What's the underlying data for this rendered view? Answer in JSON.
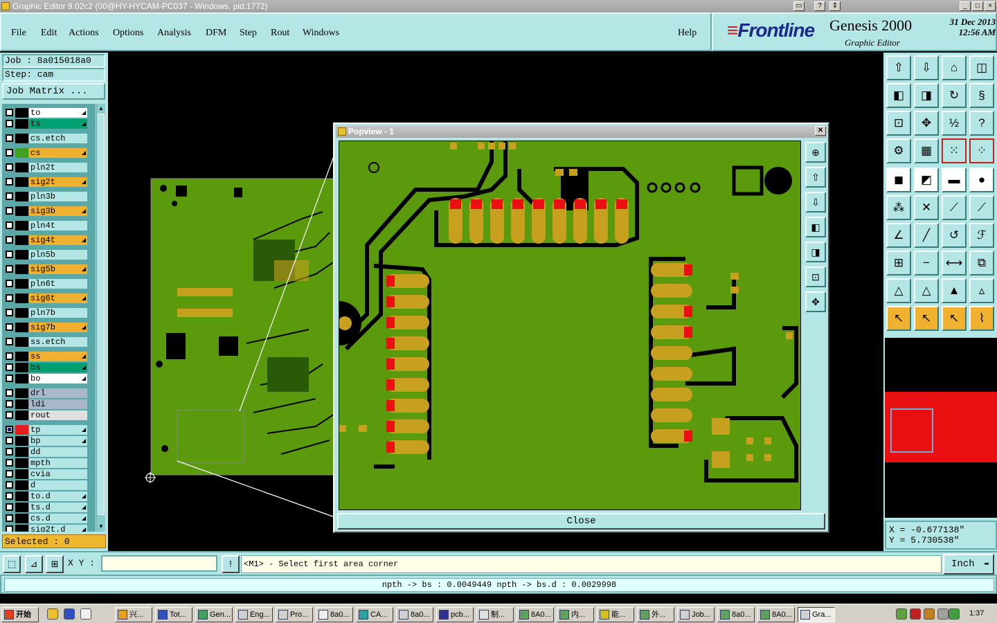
{
  "window": {
    "title": "Graphic Editor 9.02c2 (00@HY-HYCAM-PC037 - Windows, pid:1772)",
    "controls": [
      "_",
      "□",
      "×"
    ],
    "helpers": [
      "▭",
      "?",
      "⇕"
    ]
  },
  "menu": {
    "items": [
      "File",
      "Edit",
      "Actions",
      "Options",
      "Analysis",
      "DFM",
      "Step",
      "Rout",
      "Windows"
    ],
    "help": "Help"
  },
  "brand": {
    "logo": "Frontline",
    "product": "Genesis 2000",
    "subtitle": "Graphic Editor",
    "date": "31 Dec 2013",
    "time": "12:56 AM"
  },
  "job": {
    "job_line": "Job : 8a015018a0",
    "step_line": "Step: cam",
    "matrix_button": "Job Matrix ..."
  },
  "layers": [
    {
      "name": "to",
      "color": "#ffffff",
      "swatch": "#000000",
      "arrow": true
    },
    {
      "name": "ts",
      "color": "#00a070",
      "swatch": "#000000",
      "arrow": true
    },
    {
      "name": "cs.etch",
      "color": "#b4e6e6",
      "swatch": "#000000",
      "arrow": false
    },
    {
      "name": "cs",
      "color": "#f0b030",
      "swatch": "#40a020",
      "arrow": true
    },
    {
      "name": "pln2t",
      "color": "#b4e6e6",
      "swatch": "#000000",
      "arrow": false
    },
    {
      "name": "sig2t",
      "color": "#f0b030",
      "swatch": "#000000",
      "arrow": true
    },
    {
      "name": "pln3b",
      "color": "#b4e6e6",
      "swatch": "#000000",
      "arrow": false
    },
    {
      "name": "sig3b",
      "color": "#f0b030",
      "swatch": "#000000",
      "arrow": true
    },
    {
      "name": "pln4t",
      "color": "#b4e6e6",
      "swatch": "#000000",
      "arrow": false
    },
    {
      "name": "sig4t",
      "color": "#f0b030",
      "swatch": "#000000",
      "arrow": true
    },
    {
      "name": "pln5b",
      "color": "#b4e6e6",
      "swatch": "#000000",
      "arrow": false
    },
    {
      "name": "sig5b",
      "color": "#f0b030",
      "swatch": "#000000",
      "arrow": true
    },
    {
      "name": "pln6t",
      "color": "#b4e6e6",
      "swatch": "#000000",
      "arrow": false
    },
    {
      "name": "sig6t",
      "color": "#f0b030",
      "swatch": "#000000",
      "arrow": true
    },
    {
      "name": "pln7b",
      "color": "#b4e6e6",
      "swatch": "#000000",
      "arrow": false
    },
    {
      "name": "sig7b",
      "color": "#f0b030",
      "swatch": "#000000",
      "arrow": true
    },
    {
      "name": "ss.etch",
      "color": "#b4e6e6",
      "swatch": "#000000",
      "arrow": false
    },
    {
      "name": "ss",
      "color": "#f0b030",
      "swatch": "#000000",
      "arrow": true
    },
    {
      "name": "bs",
      "color": "#00a070",
      "swatch": "#000000",
      "arrow": true
    },
    {
      "name": "bo",
      "color": "#ffffff",
      "swatch": "#000000",
      "arrow": true
    },
    {
      "name": "drl",
      "color": "#a8b8c8",
      "swatch": "#000000",
      "arrow": false
    },
    {
      "name": "ldi",
      "color": "#a8b8c8",
      "swatch": "#000000",
      "arrow": false
    },
    {
      "name": "rout",
      "color": "#e0e0e0",
      "swatch": "#000000",
      "arrow": false
    },
    {
      "name": "tp",
      "color": "#b4e6e6",
      "swatch": "#e02020",
      "arrow": true,
      "checked": true
    },
    {
      "name": "bp",
      "color": "#b4e6e6",
      "swatch": "#000000",
      "arrow": true
    },
    {
      "name": "dd",
      "color": "#b4e6e6",
      "swatch": "#000000",
      "arrow": false
    },
    {
      "name": "mpth",
      "color": "#b4e6e6",
      "swatch": "#000000",
      "arrow": false
    },
    {
      "name": "cvia",
      "color": "#b4e6e6",
      "swatch": "#000000",
      "arrow": false
    },
    {
      "name": "d",
      "color": "#b4e6e6",
      "swatch": "#000000",
      "arrow": false
    },
    {
      "name": "to.d",
      "color": "#b4e6e6",
      "swatch": "#000000",
      "arrow": true
    },
    {
      "name": "ts.d",
      "color": "#b4e6e6",
      "swatch": "#000000",
      "arrow": true
    },
    {
      "name": "cs.d",
      "color": "#b4e6e6",
      "swatch": "#000000",
      "arrow": true
    },
    {
      "name": "sig2t.d",
      "color": "#b4e6e6",
      "swatch": "#000000",
      "arrow": true
    }
  ],
  "selected_label": "Selected : 0",
  "popup": {
    "title": "Popview - 1",
    "close_label": "Close"
  },
  "coords": {
    "x_line": "X = -0.677138\"",
    "y_line": "Y = 5.730538\""
  },
  "command": {
    "xy_label": "X Y :",
    "xy_value": "",
    "bang": "!",
    "prompt": "<M1> - Select first area corner",
    "units": "Inch"
  },
  "status_line": "npth -> bs : 0.0049449   npth -> bs.d : 0.0029998",
  "taskbar": {
    "start": "开始",
    "tasks": [
      "兴...",
      "Tot...",
      "Gen...",
      "Eng...",
      "Pro...",
      "8a0...",
      "CA...",
      "8a0...",
      "pcb...",
      "制...",
      "8A0...",
      "内...",
      "能...",
      "外...",
      "Job...",
      "8a0...",
      "8A0...",
      "Gra..."
    ],
    "clock": "1:37"
  },
  "colors": {
    "panel": "#b4e6e6",
    "board": "#5a9a0c",
    "pad": "#c8a020",
    "accent": "#f0b030"
  }
}
